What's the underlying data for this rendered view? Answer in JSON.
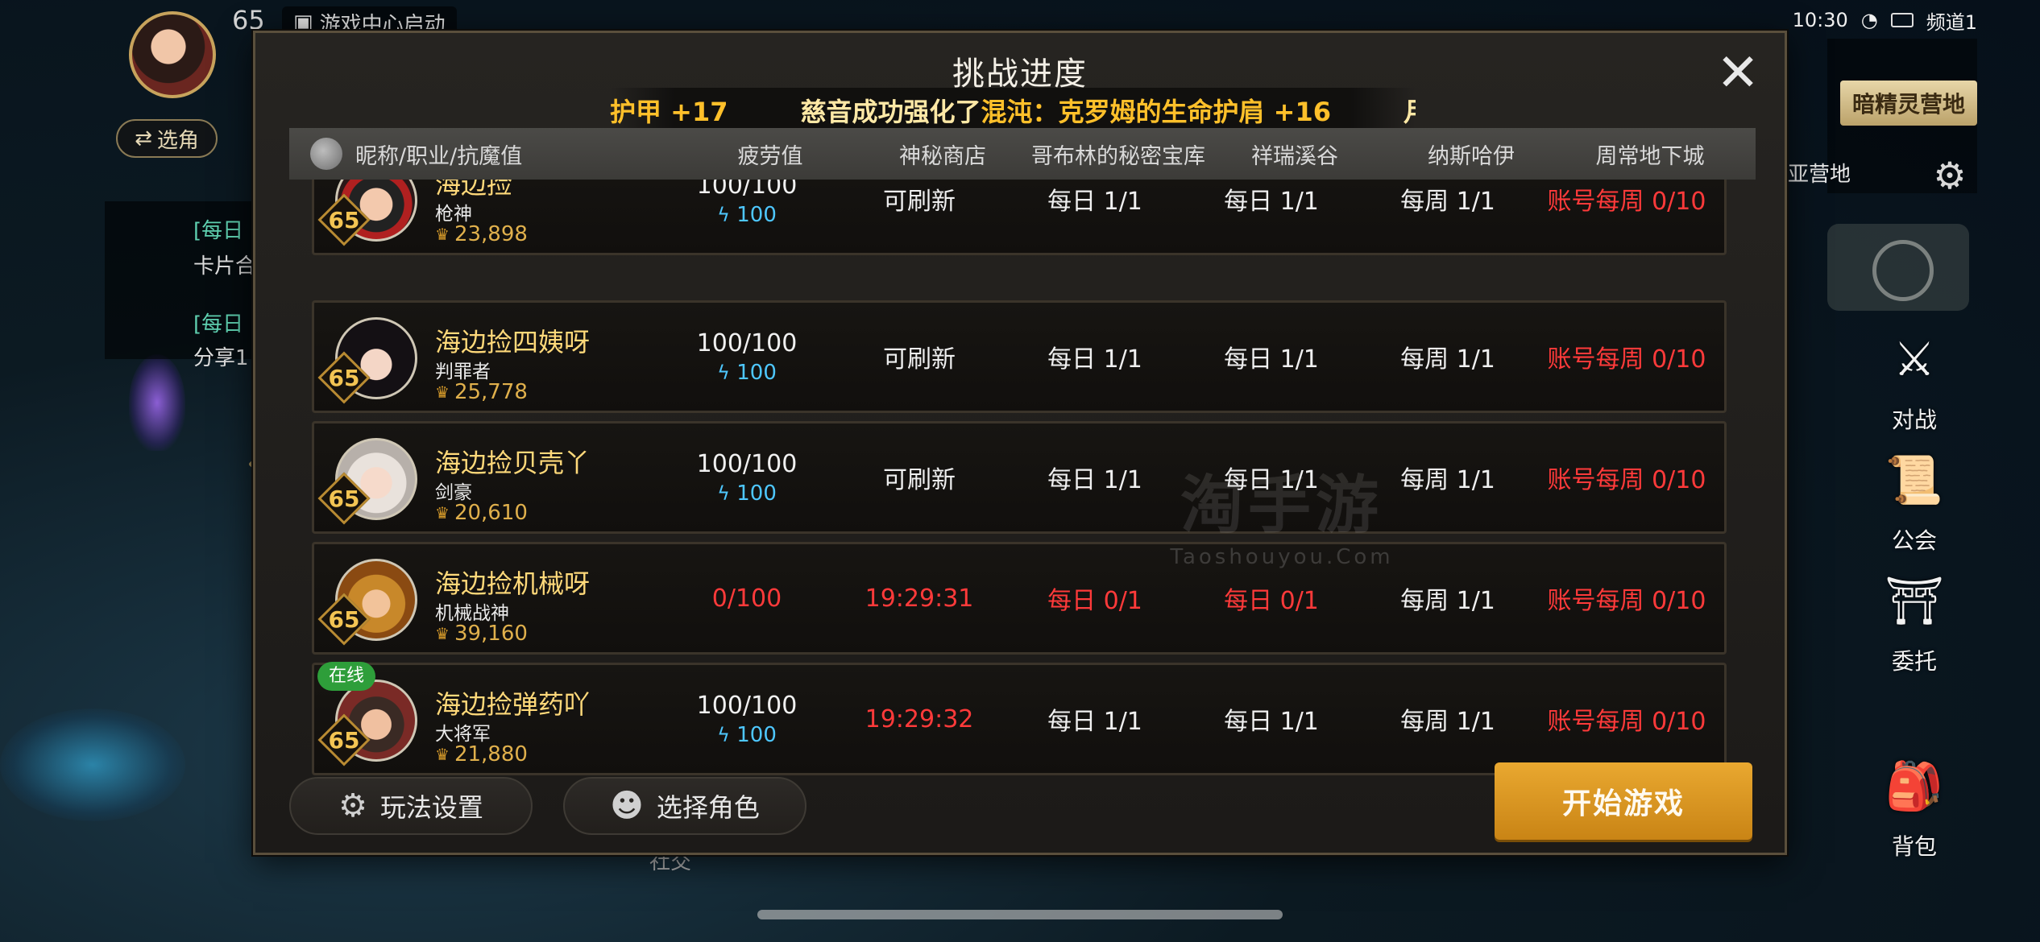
{
  "hud": {
    "level": "65",
    "game_center": "游戏中心启动",
    "select_role": "选角",
    "quest_lines": [
      "[每日",
      "卡片合",
      "[每日",
      "分享1"
    ],
    "time": "10:30",
    "channel": "频道1",
    "map_label": "暗精灵营地",
    "map_sub": "亚营地",
    "side_buttons": [
      "对战",
      "公会",
      "委托",
      "背包"
    ],
    "bottom_left": "社交"
  },
  "dialog": {
    "title": "挑战进度",
    "ticker": {
      "prefix": "护甲 +17",
      "msg_a": "慈音成功强化了",
      "msg_b": "混沌：克罗姆的生命护肩 +16",
      "suffix": "月:"
    },
    "headers": {
      "name": "昵称/职业/抗魔值",
      "fatigue": "疲劳值",
      "shop": "神秘商店",
      "goblin": "哥布林的秘密宝库",
      "valley": "祥瑞溪谷",
      "nas": "纳斯哈伊",
      "weekly": "周常地下城"
    },
    "rows": [
      {
        "name": "海边捡",
        "class": "枪神",
        "power": "23,898",
        "level": "65",
        "fatigue": "100/100",
        "fatigue_sub": "100",
        "shop": "可刷新",
        "goblin": "每日 1/1",
        "valley": "每日 1/1",
        "nas": "每周 1/1",
        "weekly": "账号每周 0/10"
      },
      {
        "name": "海边捡四姨呀",
        "class": "判罪者",
        "power": "25,778",
        "level": "65",
        "fatigue": "100/100",
        "fatigue_sub": "100",
        "shop": "可刷新",
        "goblin": "每日 1/1",
        "valley": "每日 1/1",
        "nas": "每周 1/1",
        "weekly": "账号每周 0/10"
      },
      {
        "name": "海边捡贝壳丫",
        "class": "剑豪",
        "power": "20,610",
        "level": "65",
        "fatigue": "100/100",
        "fatigue_sub": "100",
        "shop": "可刷新",
        "goblin": "每日 1/1",
        "valley": "每日 1/1",
        "nas": "每周 1/1",
        "weekly": "账号每周 0/10"
      },
      {
        "name": "海边捡机械呀",
        "class": "机械战神",
        "power": "39,160",
        "level": "65",
        "fatigue": "0/100",
        "fatigue_sub": "",
        "shop": "19:29:31",
        "goblin": "每日 0/1",
        "valley": "每日 0/1",
        "nas": "每周 1/1",
        "weekly": "账号每周 0/10"
      },
      {
        "name": "海边捡弹药吖",
        "class": "大将军",
        "power": "21,880",
        "level": "65",
        "fatigue": "100/100",
        "fatigue_sub": "100",
        "shop": "19:29:32",
        "goblin": "每日 1/1",
        "valley": "每日 1/1",
        "nas": "每周 1/1",
        "weekly": "账号每周 0/10",
        "online": "在线"
      }
    ],
    "watermark_cn": "淘手游",
    "watermark_en": "Taoshouyou.Com",
    "btn_settings": "玩法设置",
    "btn_select_role": "选择角色",
    "btn_start": "开始游戏"
  },
  "colors": {
    "accent_gold": "#e9a830",
    "name_gold": "#ffd97a",
    "alert_red": "#ff3a3a",
    "fatigue_blue": "#4ec7ff"
  }
}
